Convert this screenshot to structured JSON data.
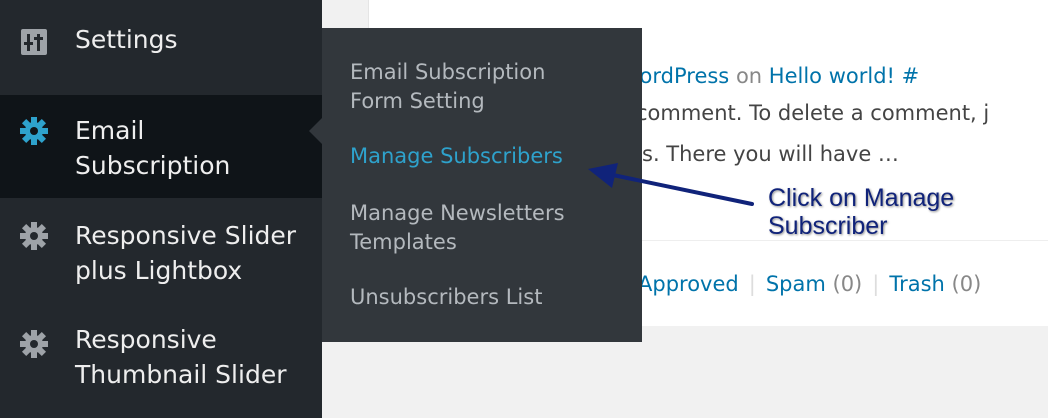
{
  "sidebar": {
    "items": [
      {
        "label": "Settings",
        "icon": "settings-sliders-icon"
      },
      {
        "label": "Email\nSubscription",
        "icon": "gear-icon",
        "active": true
      },
      {
        "label": "Responsive Slider\nplus Lightbox",
        "icon": "gear-icon"
      },
      {
        "label": "Responsive\nThumbnail Slider",
        "icon": "gear-icon"
      }
    ]
  },
  "submenu": {
    "items": [
      {
        "label": "Email Subscription\nForm Setting"
      },
      {
        "label": "Manage Subscribers",
        "current": true
      },
      {
        "label": "Manage Newsletters\nTemplates"
      },
      {
        "label": "Unsubscribers List"
      }
    ]
  },
  "comment": {
    "author": "WordPress",
    "on_text": "on",
    "post_link": "Hello world! #",
    "line2": "comment. To delete a comment, j",
    "line3": "s. There you will have …"
  },
  "filters": {
    "approved": "Approved",
    "spam": "Spam",
    "spam_count": "(0)",
    "trash": "Trash",
    "trash_count": "(0)"
  },
  "annotation": {
    "text": "Click on Manage\nSubscriber"
  },
  "colors": {
    "sidebar_bg": "#23282d",
    "submenu_bg": "#32373c",
    "accent": "#2ea2cc",
    "link": "#0073aa",
    "annotation": "#10237a"
  }
}
